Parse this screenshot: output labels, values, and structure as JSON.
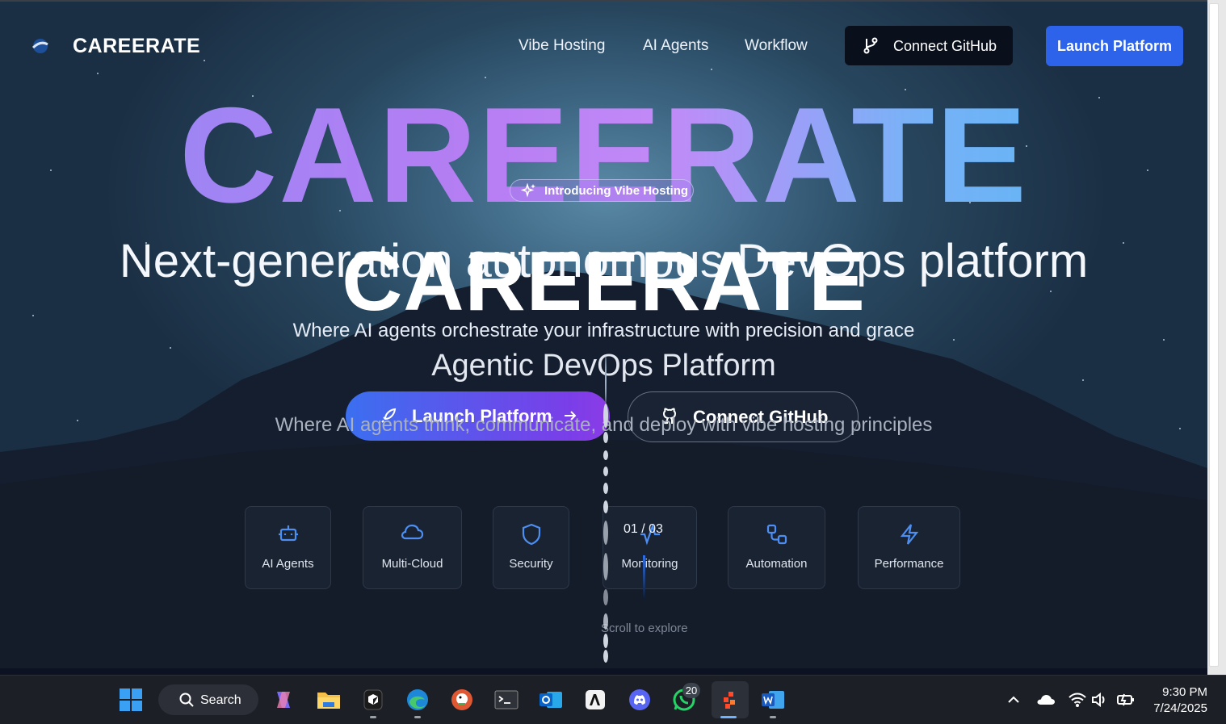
{
  "header": {
    "brand": "CAREERATE",
    "nav": [
      "Vibe Hosting",
      "AI Agents",
      "Workflow"
    ],
    "connect_github": "Connect GitHub",
    "launch_platform": "Launch Platform"
  },
  "hero": {
    "big_title": "CAREERATE",
    "badge": "Introducing Vibe Hosting",
    "headline": "Next-generation autonomous DevOps platform",
    "overlay_title": "CAREERATE",
    "subtitle": "Where AI agents orchestrate your infrastructure with precision and grace",
    "tagline": "Agentic DevOps Platform",
    "description": "Where AI agents think, communicate, and deploy with vibe hosting principles",
    "cta_launch": "Launch Platform",
    "cta_github": "Connect GitHub"
  },
  "features": [
    {
      "label": "AI Agents",
      "icon": "bot-icon"
    },
    {
      "label": "Multi-Cloud",
      "icon": "cloud-icon"
    },
    {
      "label": "Security",
      "icon": "shield-icon"
    },
    {
      "label": "Monitoring",
      "icon": "activity-icon"
    },
    {
      "label": "Automation",
      "icon": "workflow-icon"
    },
    {
      "label": "Performance",
      "icon": "zap-icon"
    }
  ],
  "slide_counter": "01 / 03",
  "scroll_hint": "Scroll to explore",
  "taskbar": {
    "search": "Search",
    "whatsapp_badge": "20",
    "time": "9:30 PM",
    "date": "7/24/2025",
    "apps": [
      "windows-start-icon",
      "copilot-icon",
      "file-explorer-icon",
      "app-icon",
      "edge-icon",
      "duckduckgo-icon",
      "terminal-icon",
      "outlook-icon",
      "anthropic-icon",
      "discord-icon",
      "whatsapp-icon",
      "active-app-icon",
      "word-icon"
    ]
  },
  "colors": {
    "accent_blue": "#2d63ea",
    "gradient_start": "#8f8af5",
    "gradient_end": "#4eb8f4",
    "feature_icon": "#4d8ef0"
  }
}
